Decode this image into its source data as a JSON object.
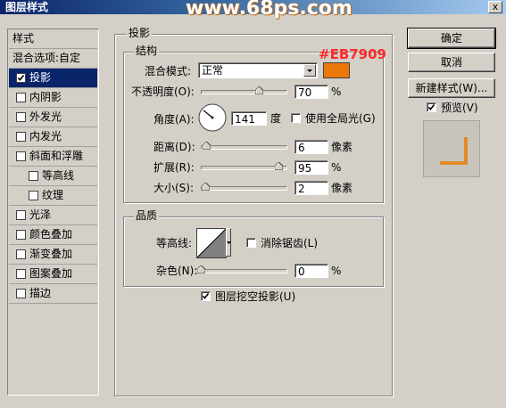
{
  "window": {
    "title": "图层样式",
    "watermark": "www.68ps.com",
    "close_glyph": "x"
  },
  "left_list": {
    "header": "样式",
    "items": [
      {
        "label": "混合选项:自定",
        "has_checkbox": false,
        "checked": false,
        "selected": false,
        "indent": false
      },
      {
        "label": "投影",
        "has_checkbox": true,
        "checked": true,
        "selected": true,
        "indent": false
      },
      {
        "label": "内阴影",
        "has_checkbox": true,
        "checked": false,
        "selected": false,
        "indent": false
      },
      {
        "label": "外发光",
        "has_checkbox": true,
        "checked": false,
        "selected": false,
        "indent": false
      },
      {
        "label": "内发光",
        "has_checkbox": true,
        "checked": false,
        "selected": false,
        "indent": false
      },
      {
        "label": "斜面和浮雕",
        "has_checkbox": true,
        "checked": false,
        "selected": false,
        "indent": false
      },
      {
        "label": "等高线",
        "has_checkbox": true,
        "checked": false,
        "selected": false,
        "indent": true
      },
      {
        "label": "纹理",
        "has_checkbox": true,
        "checked": false,
        "selected": false,
        "indent": true
      },
      {
        "label": "光泽",
        "has_checkbox": true,
        "checked": false,
        "selected": false,
        "indent": false
      },
      {
        "label": "颜色叠加",
        "has_checkbox": true,
        "checked": false,
        "selected": false,
        "indent": false
      },
      {
        "label": "渐变叠加",
        "has_checkbox": true,
        "checked": false,
        "selected": false,
        "indent": false
      },
      {
        "label": "图案叠加",
        "has_checkbox": true,
        "checked": false,
        "selected": false,
        "indent": false
      },
      {
        "label": "描边",
        "has_checkbox": true,
        "checked": false,
        "selected": false,
        "indent": false
      }
    ]
  },
  "shadow": {
    "group_title": "投影",
    "structure_title": "结构",
    "color_annotation": "#EB7909",
    "color_swatch": "#eb7909",
    "blend_mode_label": "混合模式:",
    "blend_mode_value": "正常",
    "opacity_label": "不透明度(O):",
    "opacity_value": "70",
    "opacity_unit": "%",
    "opacity_level": 0.7,
    "angle_label": "角度(A):",
    "angle_value": "141",
    "angle_unit": "度",
    "global_light_label": "使用全局光(G)",
    "global_light_checked": false,
    "distance_label": "距离(D):",
    "distance_value": "6",
    "distance_unit": "像素",
    "distance_level": 0.02,
    "spread_label": "扩展(R):",
    "spread_value": "95",
    "spread_unit": "%",
    "spread_level": 0.95,
    "size_label": "大小(S):",
    "size_value": "2",
    "size_unit": "像素",
    "size_level": 0.01
  },
  "quality": {
    "group_title": "品质",
    "contour_label": "等高线:",
    "antialias_label": "消除锯齿(L)",
    "antialias_checked": false,
    "noise_label": "杂色(N):",
    "noise_value": "0",
    "noise_unit": "%",
    "noise_level": 0.0,
    "knockout_label": "图层挖空投影(U)",
    "knockout_checked": true
  },
  "buttons": {
    "ok": "确定",
    "cancel": "取消",
    "new_style": "新建样式(W)...",
    "preview_label": "预览(V)",
    "preview_checked": true
  },
  "colors": {
    "selection": "#0a246a",
    "annotation": "#ff2a2a",
    "preview_shadow": "#e08a2a"
  }
}
